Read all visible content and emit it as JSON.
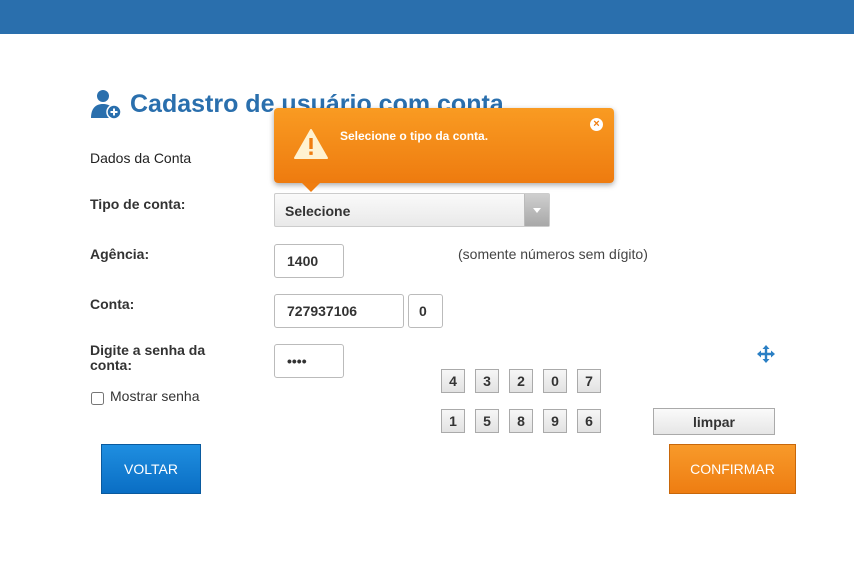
{
  "header": {
    "bg_color": "#2a6fad"
  },
  "page": {
    "title": "Cadastro de usuário com conta",
    "title_icon": "user-add-icon"
  },
  "section": {
    "label": "Dados da Conta"
  },
  "form": {
    "account_type_label": "Tipo de conta:",
    "account_type_value": "Selecione",
    "agency_label": "Agência:",
    "agency_value": "1400",
    "agency_hint": "(somente números sem dígito)",
    "account_label": "Conta:",
    "account_value": "727937106",
    "account_digit": "0",
    "password_label_1": "Digite a senha da",
    "password_label_2": "conta:",
    "password_value": "••••",
    "show_password_label": "Mostrar senha"
  },
  "keypad": {
    "row1": [
      "4",
      "3",
      "2",
      "0",
      "7"
    ],
    "row2": [
      "1",
      "5",
      "8",
      "9",
      "6"
    ],
    "clear_label": "limpar"
  },
  "buttons": {
    "back_label": "VOLTAR",
    "confirm_label": "CONFIRMAR"
  },
  "tooltip": {
    "message": "Selecione o tipo da conta.",
    "color": "#f39019"
  }
}
